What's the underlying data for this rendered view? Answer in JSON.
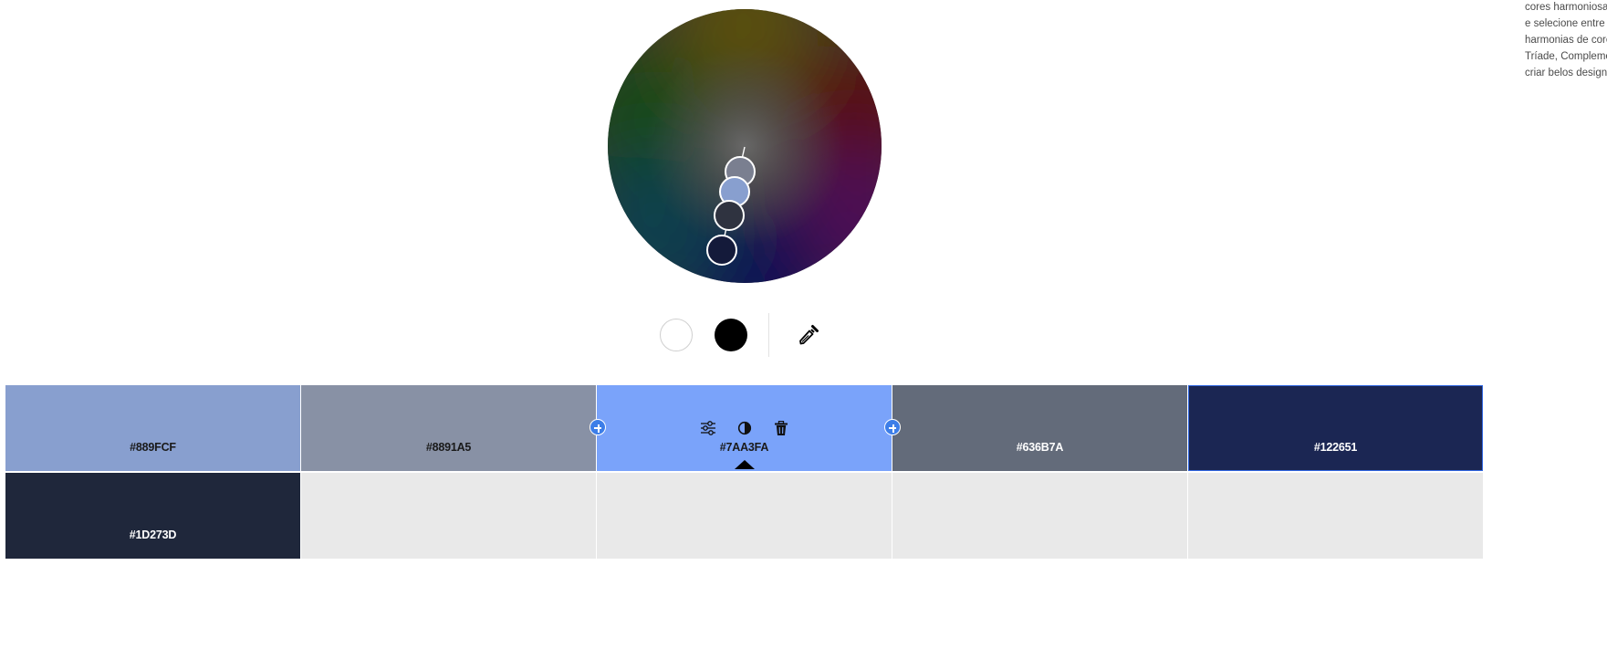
{
  "side_text": {
    "lines": [
      "cores harmoniosas",
      "e selecione entre u",
      "harmonias de core",
      "Tríade, Complemen",
      "criar belos designs"
    ]
  },
  "wheel": {
    "rotation_handle": "hue-marker-line",
    "markers": [
      "base-color-marker",
      "marker-2",
      "marker-3",
      "marker-4"
    ]
  },
  "controls": {
    "white_button": "white-color",
    "black_button": "black-color",
    "eyedropper_icon": "eyedropper-icon"
  },
  "swatches": [
    {
      "hex": "#889FCF",
      "color": "#889FCF",
      "text_style": "dark"
    },
    {
      "hex": "#8891A5",
      "color": "#8891A5",
      "text_style": "dark"
    },
    {
      "hex": "#7AA3FA",
      "color": "#7AA3FA",
      "text_style": "dark",
      "active": true
    },
    {
      "hex": "#636B7A",
      "color": "#636B7A",
      "text_style": "light"
    },
    {
      "hex": "#122651",
      "color": "#1B2653",
      "text_style": "light",
      "selected": true
    },
    {
      "hex": "#1D273D",
      "color": "#1F273B",
      "text_style": "light"
    }
  ],
  "swatch_tools": [
    "sliders-icon",
    "contrast-icon",
    "trash-icon"
  ],
  "colors": {
    "accent": "#3D7EE8",
    "empty_cell": "#E9E9E9"
  }
}
